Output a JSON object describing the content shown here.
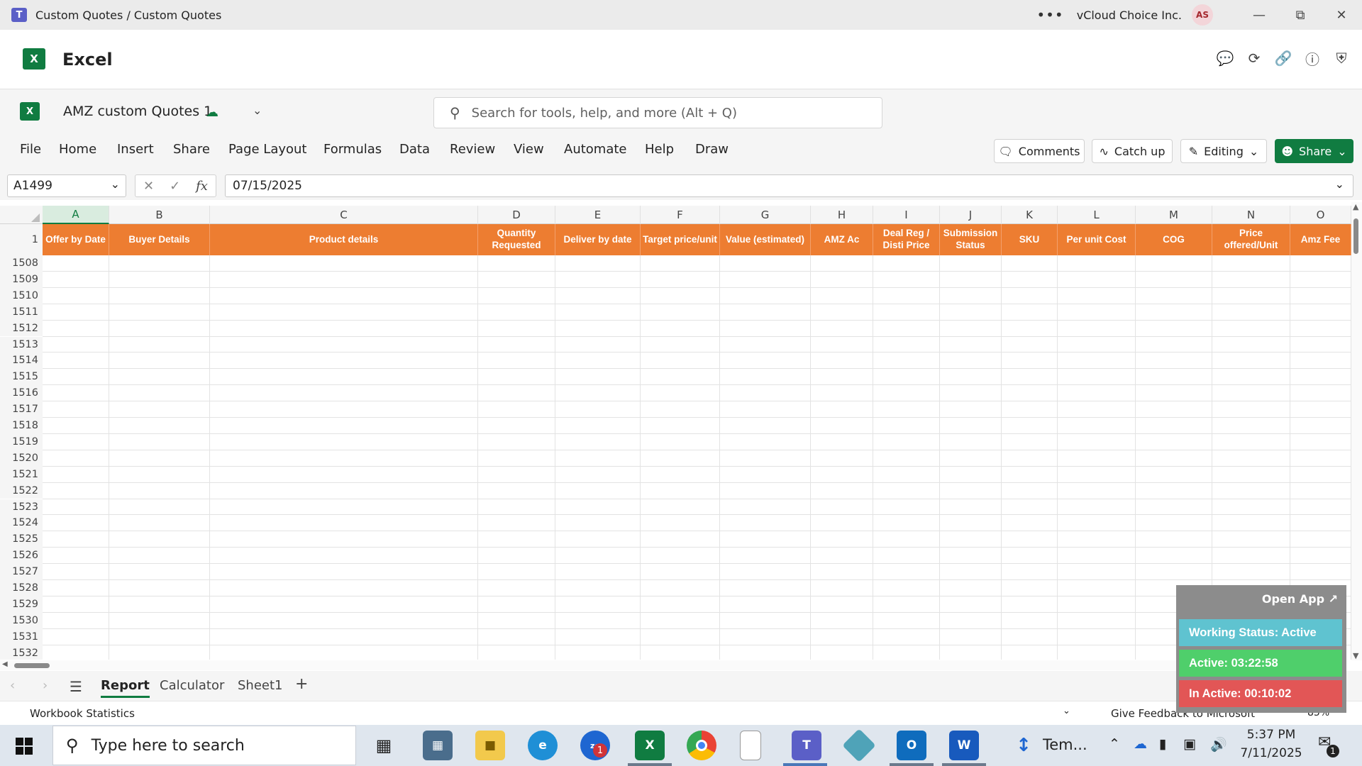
{
  "window": {
    "title": "Custom Quotes / Custom Quotes",
    "org": "vCloud Choice Inc.",
    "avatar_initials": "AS",
    "more": "•••"
  },
  "app": {
    "name": "Excel",
    "logo_letter": "X"
  },
  "document": {
    "name": "AMZ custom Quotes 1"
  },
  "search": {
    "placeholder": "Search for tools, help, and more (Alt + Q)"
  },
  "menu": [
    "File",
    "Home",
    "Insert",
    "Share",
    "Page Layout",
    "Formulas",
    "Data",
    "Review",
    "View",
    "Automate",
    "Help",
    "Draw"
  ],
  "ribbon_buttons": {
    "comments": "Comments",
    "catchup": "Catch up",
    "editing": "Editing",
    "share": "Share"
  },
  "formula": {
    "cell_ref": "A1499",
    "value": "07/15/2025",
    "fx": "fx"
  },
  "columns": [
    "A",
    "B",
    "C",
    "D",
    "E",
    "F",
    "G",
    "H",
    "I",
    "J",
    "K",
    "L",
    "M",
    "N",
    "O"
  ],
  "selected_column": "A",
  "header_row_number": "1",
  "headers": [
    "Offer by Date",
    "Buyer Details",
    "Product details",
    "Quantity Requested",
    "Deliver by date",
    "Target price/unit",
    "Value (estimated)",
    "AMZ Ac",
    "Deal Reg / Disti Price",
    "Submission Status",
    "SKU",
    "Per unit Cost",
    "COG",
    "Price offered/Unit",
    "Amz Fee"
  ],
  "rows": [
    "1508",
    "1509",
    "1510",
    "1511",
    "1512",
    "1513",
    "1514",
    "1515",
    "1516",
    "1517",
    "1518",
    "1519",
    "1520",
    "1521",
    "1522",
    "1523",
    "1524",
    "1525",
    "1526",
    "1527",
    "1528",
    "1529",
    "1530",
    "1531",
    "1532"
  ],
  "sheets": {
    "tabs": [
      "Report",
      "Calculator",
      "Sheet1"
    ],
    "active": "Report",
    "add": "+"
  },
  "statusbar": {
    "left": "Workbook Statistics",
    "feedback": "Give Feedback to Microsoft",
    "zoom": "85%"
  },
  "widget": {
    "open_app": "Open App ↗",
    "working_status": "Working Status: Active",
    "active": "Active: 03:22:58",
    "inactive": "In Active: 00:10:02",
    "colors": {
      "status": "#5fc3d0",
      "active": "#4fcf6b",
      "inactive": "#e25656"
    }
  },
  "taskbar": {
    "search_placeholder": "Type here to search",
    "zoom_badge": "1",
    "temp_label": "Tem...",
    "time": "5:37 PM",
    "date": "7/11/2025",
    "notifications": "1"
  },
  "colors": {
    "accent": "#107c41",
    "header_fill": "#ed7d31"
  }
}
